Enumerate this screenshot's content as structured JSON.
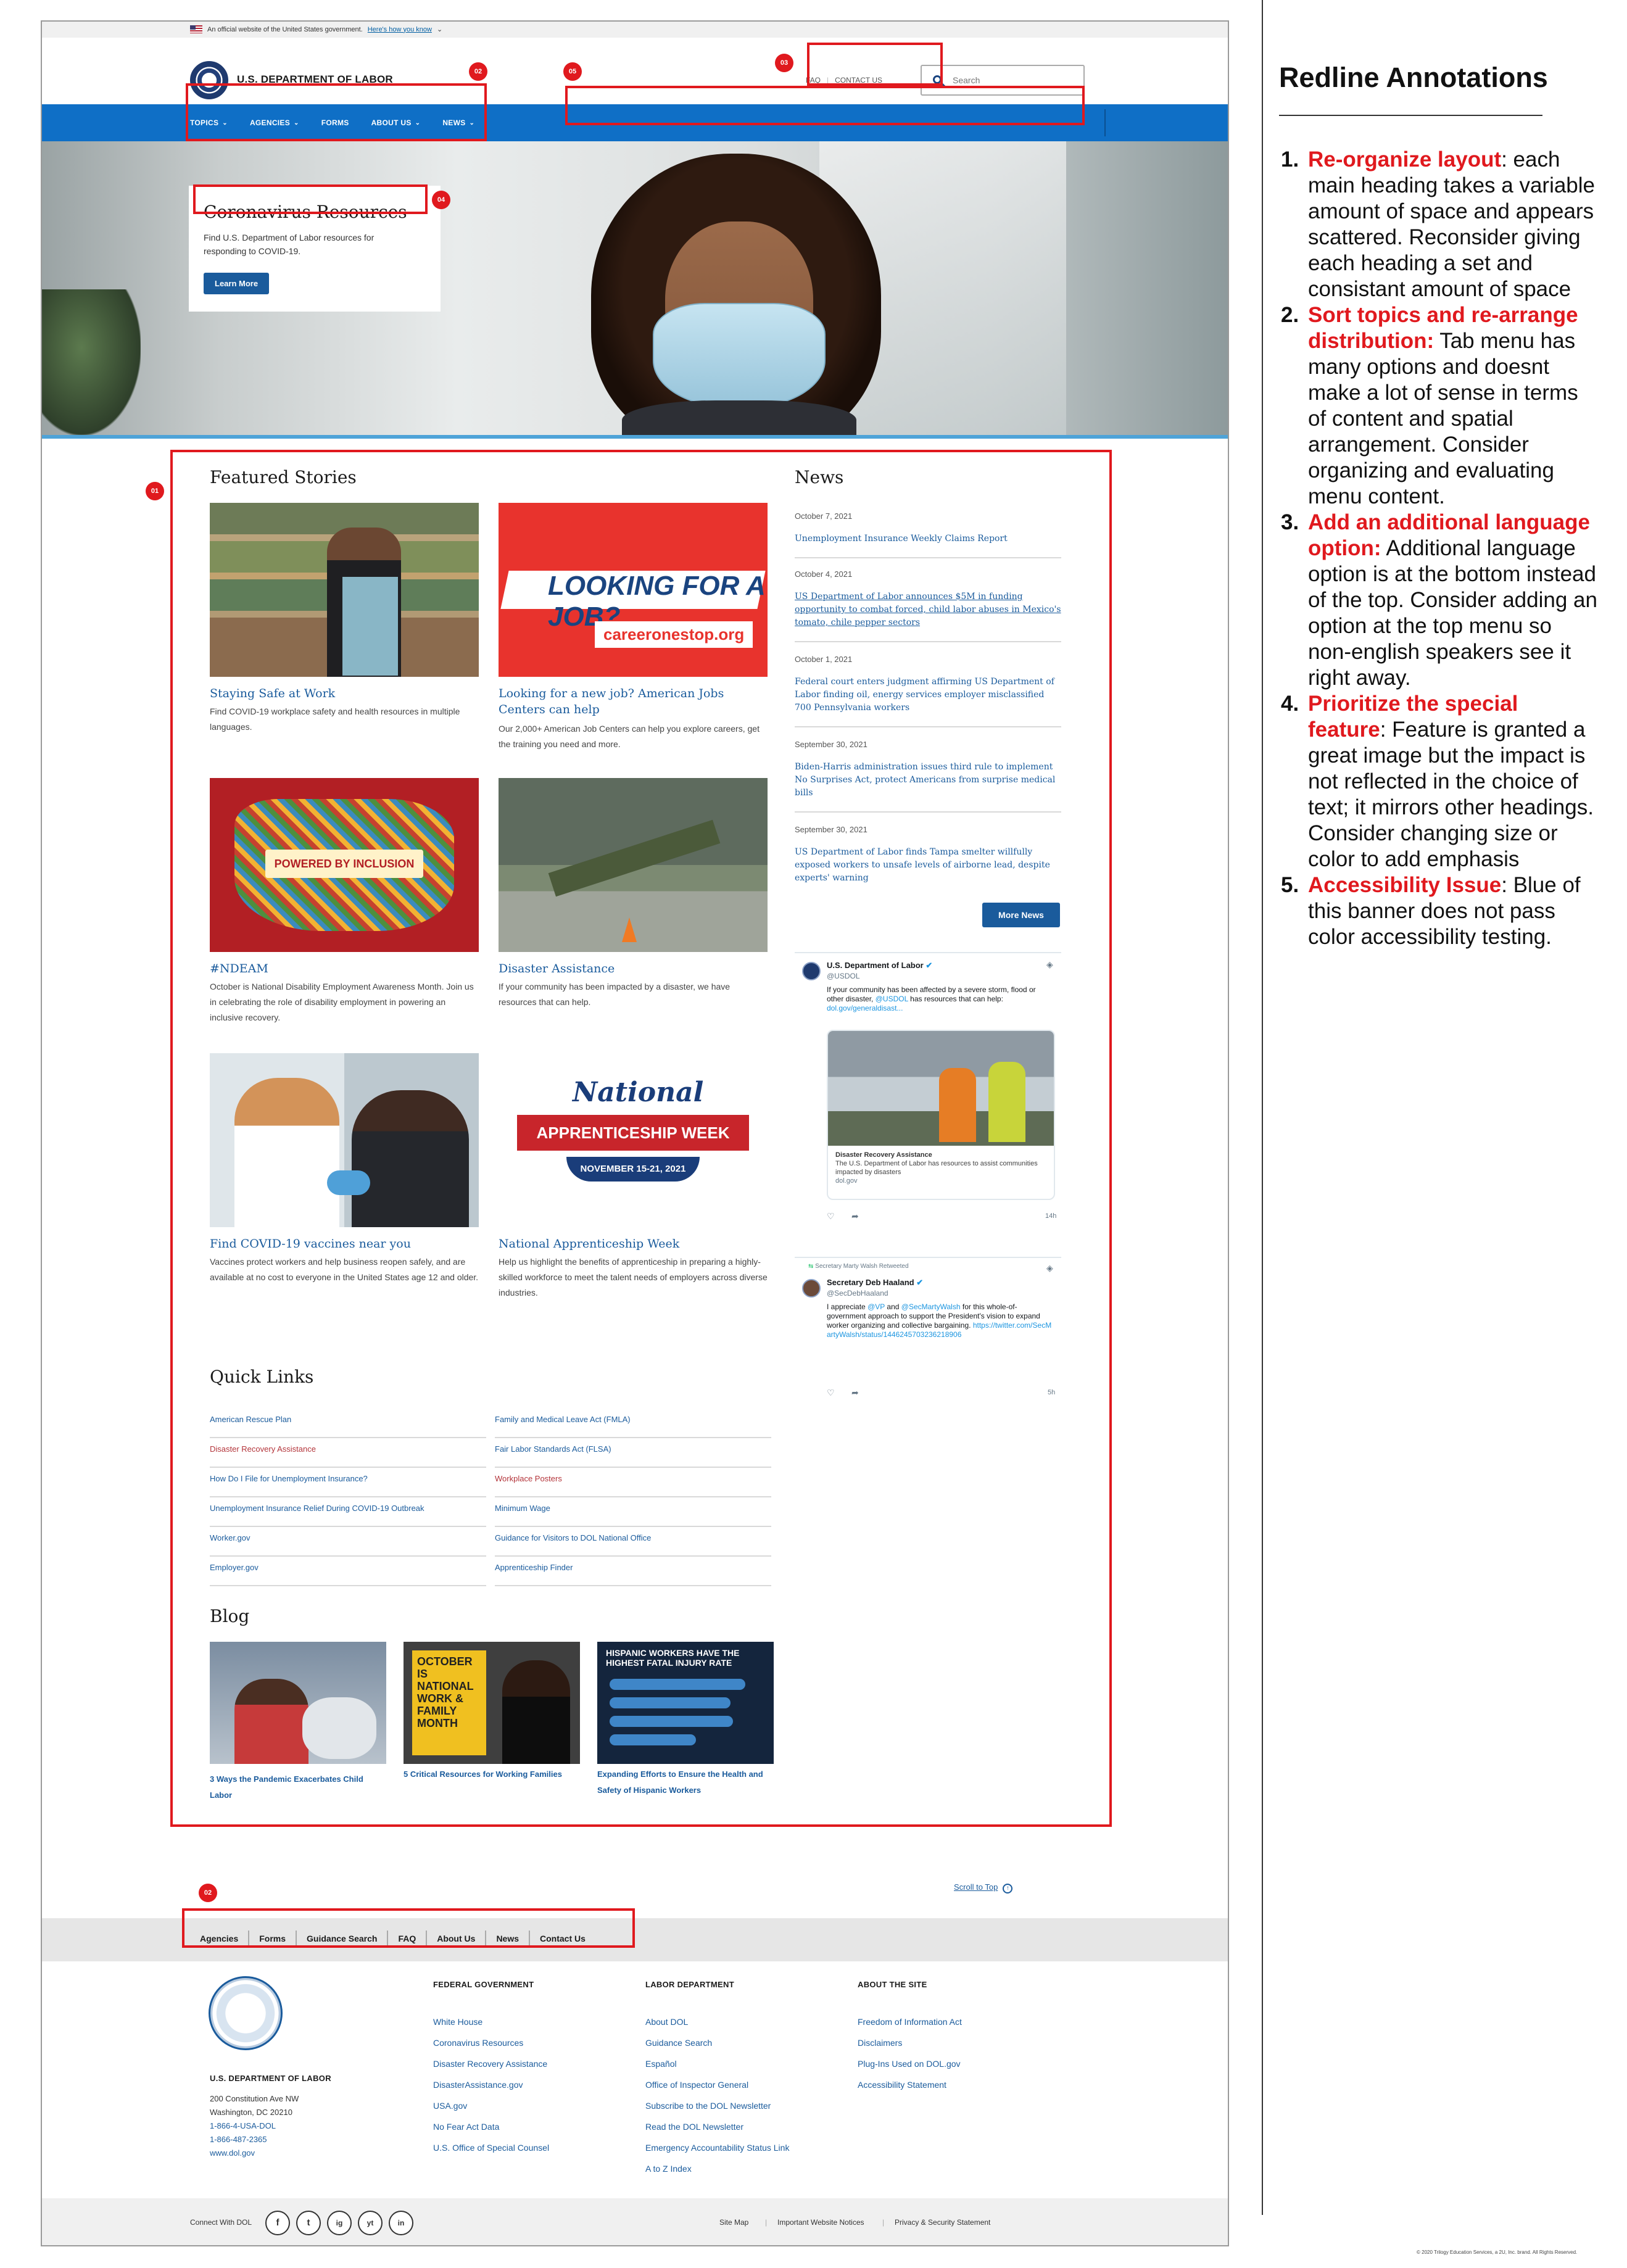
{
  "gov_banner": {
    "text": "An official website of the United States government.",
    "link": "Here's how you know"
  },
  "header": {
    "site_title": "U.S. DEPARTMENT OF LABOR",
    "util_links": [
      "FAQ",
      "CONTACT US"
    ],
    "search_placeholder": "Search"
  },
  "nav": {
    "items": [
      "TOPICS",
      "AGENCIES",
      "FORMS",
      "ABOUT US",
      "NEWS"
    ]
  },
  "hero": {
    "title": "Coronavirus Resources",
    "text": "Find U.S. Department of Labor resources for responding to COVID-19.",
    "button": "Learn More"
  },
  "annotations": {
    "tags": [
      "01",
      "02",
      "03",
      "04",
      "05",
      "02"
    ]
  },
  "featured": {
    "title": "Featured Stories",
    "cards": [
      {
        "title": "Staying Safe at Work",
        "text": "Find COVID-19 workplace safety and health resources in multiple languages."
      },
      {
        "title": "Looking for a new job? American Jobs Centers can help",
        "text": "Our 2,000+ American Job Centers can help you explore careers, get the training you need and more."
      },
      {
        "title": "#NDEAM",
        "text": "October is National Disability Employment Awareness Month. Join us in celebrating the role of disability employment in powering an inclusive recovery."
      },
      {
        "title": "Disaster Assistance",
        "text": "If your community has been impacted by a disaster, we have resources that can help."
      },
      {
        "title": "Find COVID-19 vaccines near you",
        "text": "Vaccines protect workers and help business reopen safely, and are available at no cost to everyone in the United States age 12 and older."
      },
      {
        "title": "National Apprenticeship Week",
        "text": "Help us highlight the benefits of apprenticeship in preparing a highly-skilled workforce to meet the talent needs of employers across diverse industries."
      }
    ],
    "image_text": {
      "job_headline": "LOOKING FOR A JOB?",
      "job_site": "careeronestop.org",
      "ndeam_banner": "POWERED BY INCLUSION",
      "appr_script": "National",
      "appr_ribbon": "APPRENTICESHIP WEEK",
      "appr_dates": "NOVEMBER 15-21, 2021"
    }
  },
  "news": {
    "title": "News",
    "items": [
      {
        "date": "October 7, 2021",
        "headline": "Unemployment Insurance Weekly Claims Report"
      },
      {
        "date": "October 4, 2021",
        "headline": "US Department of Labor announces $5M in funding opportunity to combat forced, child labor abuses in Mexico's tomato, chile pepper sectors"
      },
      {
        "date": "October 1, 2021",
        "headline": "Federal court enters judgment affirming US Department of Labor finding oil, energy services employer misclassified 700 Pennsylvania workers"
      },
      {
        "date": "September 30, 2021",
        "headline": "Biden-Harris administration issues third rule to implement No Surprises Act, protect Americans from surprise medical bills"
      },
      {
        "date": "September 30, 2021",
        "headline": "US Department of Labor finds Tampa smelter willfully exposed workers to unsafe levels of airborne lead, despite experts' warning"
      }
    ],
    "more_button": "More News"
  },
  "tweets": [
    {
      "name": "U.S. Department of Labor",
      "handle": "@USDOL",
      "text": "If your community has been affected by a severe storm, flood or other disaster,",
      "mention": "@USDOL",
      "text2": "has resources that can help:",
      "link": "dol.gov/generaldisast...",
      "card_title": "Disaster Recovery Assistance",
      "card_text": "The U.S. Department of Labor has resources to assist communities impacted by disasters",
      "card_domain": "dol.gov",
      "time": "14h"
    },
    {
      "retweet": "Secretary Marty Walsh Retweeted",
      "name": "Secretary Deb Haaland",
      "handle": "@SecDebHaaland",
      "text": "I appreciate",
      "mention1": "@VP",
      "and": "and",
      "mention2": "@SecMartyWalsh",
      "text2": "for this whole-of-government approach to support the President's vision to expand worker organizing and collective bargaining.",
      "link": "https://twitter.com/SecMartyWalsh/status/1446245703236218906",
      "time": "5h"
    }
  ],
  "quick_links": {
    "title": "Quick Links",
    "left": [
      "American Rescue Plan",
      "Disaster Recovery Assistance",
      "How Do I File for Unemployment Insurance?",
      "Unemployment Insurance Relief During COVID-19 Outbreak",
      "Worker.gov",
      "Employer.gov"
    ],
    "right": [
      "Family and Medical Leave Act (FMLA)",
      "Fair Labor Standards Act (FLSA)",
      "Workplace Posters",
      "Minimum Wage",
      "Guidance for Visitors to DOL National Office",
      "Apprenticeship Finder"
    ]
  },
  "blog": {
    "title": "Blog",
    "posts": [
      {
        "title": "3 Ways the Pandemic Exacerbates Child Labor"
      },
      {
        "title": "5 Critical Resources for Working Families"
      },
      {
        "title": "Expanding Efforts to Ensure the Health and Safety of Hispanic Workers"
      }
    ],
    "image_text": {
      "family": "OCTOBER IS NATIONAL WORK & FAMILY MONTH",
      "hispanic": "HISPANIC WORKERS HAVE THE HIGHEST FATAL INJURY RATE"
    }
  },
  "scroll_top": "Scroll to Top",
  "footer_nav": [
    "Agencies",
    "Forms",
    "Guidance Search",
    "FAQ",
    "About Us",
    "News",
    "Contact Us"
  ],
  "footer": {
    "org_name": "U.S. DEPARTMENT OF LABOR",
    "address": [
      "200 Constitution Ave NW",
      "Washington, DC 20210"
    ],
    "phones": [
      "1-866-4-USA-DOL",
      "1-866-487-2365"
    ],
    "website": "www.dol.gov",
    "columns": [
      {
        "title": "FEDERAL GOVERNMENT",
        "links": [
          "White House",
          "Coronavirus Resources",
          "Disaster Recovery Assistance",
          "DisasterAssistance.gov",
          "USA.gov",
          "No Fear Act Data",
          "U.S. Office of Special Counsel"
        ]
      },
      {
        "title": "LABOR DEPARTMENT",
        "links": [
          "About DOL",
          "Guidance Search",
          "Español",
          "Office of Inspector General",
          "Subscribe to the DOL Newsletter",
          "Read the DOL Newsletter",
          "Emergency Accountability Status Link",
          "A to Z Index"
        ]
      },
      {
        "title": "ABOUT THE SITE",
        "links": [
          "Freedom of Information Act",
          "Disclaimers",
          "Plug-Ins Used on DOL.gov",
          "Accessibility Statement"
        ]
      }
    ],
    "connect": "Connect With DOL",
    "social": [
      "f",
      "t",
      "ig",
      "yt",
      "in"
    ],
    "bottom_links": [
      "Site Map",
      "Important Website Notices",
      "Privacy & Security Statement"
    ]
  },
  "annotation_panel": {
    "title": "Redline Annotations",
    "items": [
      {
        "num": "1.",
        "heading": "Re-organize layout",
        "body": ": each main heading takes a variable amount of space and appears scattered. Reconsider giving each heading a set and consistant amount of space"
      },
      {
        "num": "2.",
        "heading": "Sort topics and re-arrange distribution:",
        "body": " Tab menu has many options and doesnt make a lot of sense in terms of content and spatial arrangement. Consider organizing and evaluating menu content."
      },
      {
        "num": "3.",
        "heading": "Add an additional language option:",
        "body": " Additional language option is at the bottom instead of the top. Consider adding an option at the top menu so non-english speakers see it right away."
      },
      {
        "num": "4.",
        "heading": "Prioritize the special feature",
        "body": ": Feature is granted a great image but the impact is not reflected in the choice of text; it mirrors other headings. Consider changing size or color to add emphasis"
      },
      {
        "num": "5.",
        "heading": "Accessibility Issue",
        "body": ": Blue of this banner does not pass color accessibility testing."
      }
    ],
    "copyright": "© 2020 Trilogy Education Services, a 2U, Inc. brand. All Rights Reserved."
  },
  "colors": {
    "nav_blue": "#0f6fc6",
    "link_blue": "#1a5b9c",
    "annotation_red": "#e0191e"
  }
}
